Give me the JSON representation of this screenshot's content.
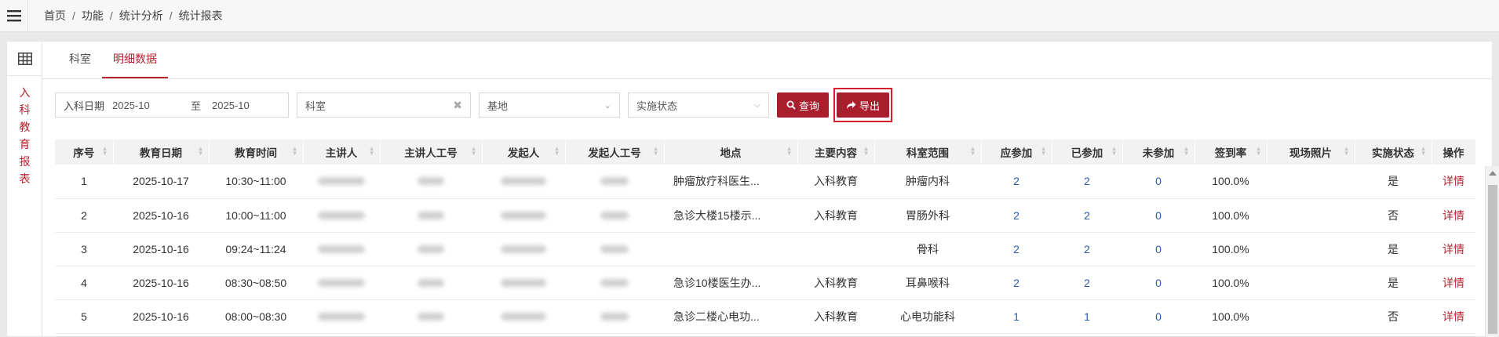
{
  "breadcrumb": [
    "首页",
    "功能",
    "统计分析",
    "统计报表"
  ],
  "breadcrumb_sep": "/",
  "sidebar": {
    "vertical_title": "入\n科\n教\n育\n报\n表"
  },
  "tabs": [
    {
      "label": "科室",
      "active": false
    },
    {
      "label": "明细数据",
      "active": true
    }
  ],
  "filters": {
    "date_label": "入科日期",
    "date_from": "2025-10",
    "date_to_label": "至",
    "date_to": "2025-10",
    "dept_placeholder": "科室",
    "dept_clear": "✖",
    "base_value": "基地",
    "status_value": "实施状态",
    "query_label": "查询",
    "export_label": "导出"
  },
  "table": {
    "columns": [
      "序号",
      "教育日期",
      "教育时间",
      "主讲人",
      "主讲人工号",
      "发起人",
      "发起人工号",
      "地点",
      "主要内容",
      "科室范围",
      "应参加",
      "已参加",
      "未参加",
      "签到率",
      "现场照片",
      "实施状态",
      "操作"
    ],
    "rows": [
      {
        "no": "1",
        "date": "2025-10-17",
        "time": "10:30~11:00",
        "place": "肿瘤放疗科医生...",
        "content": "入科教育",
        "dept": "肿瘤内科",
        "should": "2",
        "attended": "2",
        "absent": "0",
        "rate": "100.0%",
        "status": "是",
        "action": "详情"
      },
      {
        "no": "2",
        "date": "2025-10-16",
        "time": "10:00~11:00",
        "place": "急诊大楼15楼示...",
        "content": "入科教育",
        "dept": "胃肠外科",
        "should": "2",
        "attended": "2",
        "absent": "0",
        "rate": "100.0%",
        "status": "否",
        "action": "详情"
      },
      {
        "no": "3",
        "date": "2025-10-16",
        "time": "09:24~11:24",
        "place": "",
        "content": "",
        "dept": "骨科",
        "should": "2",
        "attended": "2",
        "absent": "0",
        "rate": "100.0%",
        "status": "是",
        "action": "详情"
      },
      {
        "no": "4",
        "date": "2025-10-16",
        "time": "08:30~08:50",
        "place": "急诊10楼医生办...",
        "content": "入科教育",
        "dept": "耳鼻喉科",
        "should": "2",
        "attended": "2",
        "absent": "0",
        "rate": "100.0%",
        "status": "是",
        "action": "详情"
      },
      {
        "no": "5",
        "date": "2025-10-16",
        "time": "08:00~08:30",
        "place": "急诊二楼心电功...",
        "content": "入科教育",
        "dept": "心电功能科",
        "should": "1",
        "attended": "1",
        "absent": "0",
        "rate": "100.0%",
        "status": "否",
        "action": "详情"
      }
    ]
  },
  "colors": {
    "accent": "#a91e2c",
    "link": "#2b5aa8",
    "highlight_border": "#d61f2c"
  }
}
